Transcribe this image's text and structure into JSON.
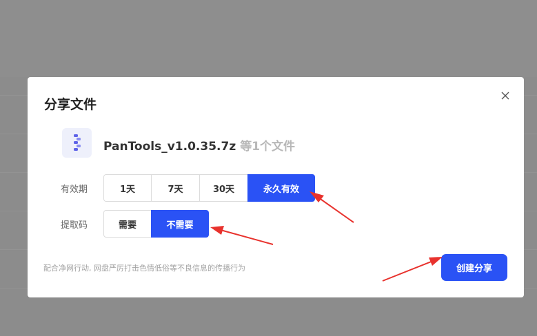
{
  "dialog": {
    "title": "分享文件",
    "close_icon": "close-icon",
    "file": {
      "icon": "zip-file-icon",
      "name": "PanTools_v1.0.35.7z",
      "count_text": "等1个文件"
    },
    "validity": {
      "label": "有效期",
      "options": [
        "1天",
        "7天",
        "30天",
        "永久有效"
      ],
      "selected": "永久有效"
    },
    "code": {
      "label": "提取码",
      "options": [
        "需要",
        "不需要"
      ],
      "selected": "不需要"
    },
    "notice": "配合净网行动, 网盘严厉打击色情低俗等不良信息的传播行为",
    "create_button": "创建分享"
  },
  "colors": {
    "accent": "#2a52f5",
    "annotation_arrow": "#e8322d",
    "overlay": "#8c8c8c"
  }
}
